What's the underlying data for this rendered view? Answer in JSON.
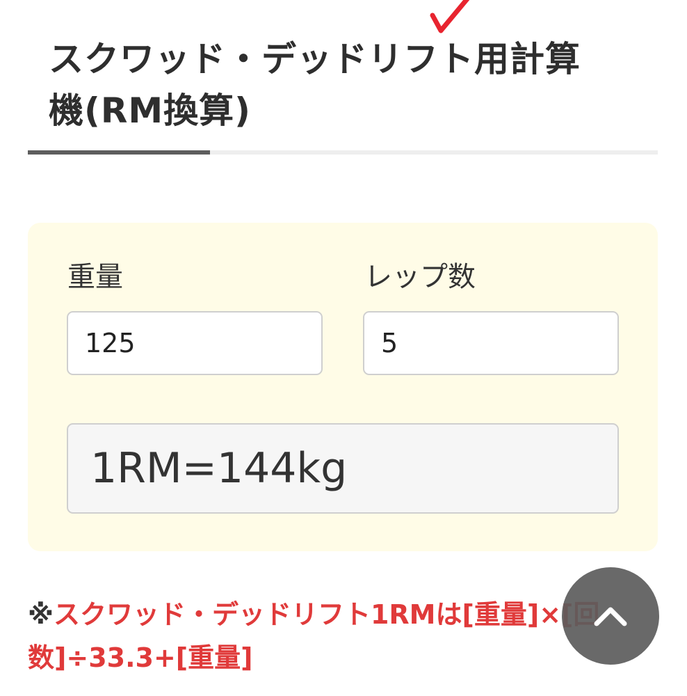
{
  "header": {
    "title": "スクワッド・デッドリフト用計算機(RM換算)"
  },
  "calculator": {
    "weight_label": "重量",
    "weight_value": "125",
    "reps_label": "レップ数",
    "reps_value": "5",
    "result": "1RM=144kg"
  },
  "note": {
    "mark": "※",
    "formula": "スクワッド・デッドリフト1RMは[重量]×[回数]÷33.3+[重量]"
  },
  "controls": {
    "scroll_top_icon": "chevron-up-icon"
  },
  "colors": {
    "panel_background": "#fffce7",
    "note_text": "#e03a3a",
    "checkmark": "#e8242f",
    "scroll_button": "#5c5c5c"
  }
}
